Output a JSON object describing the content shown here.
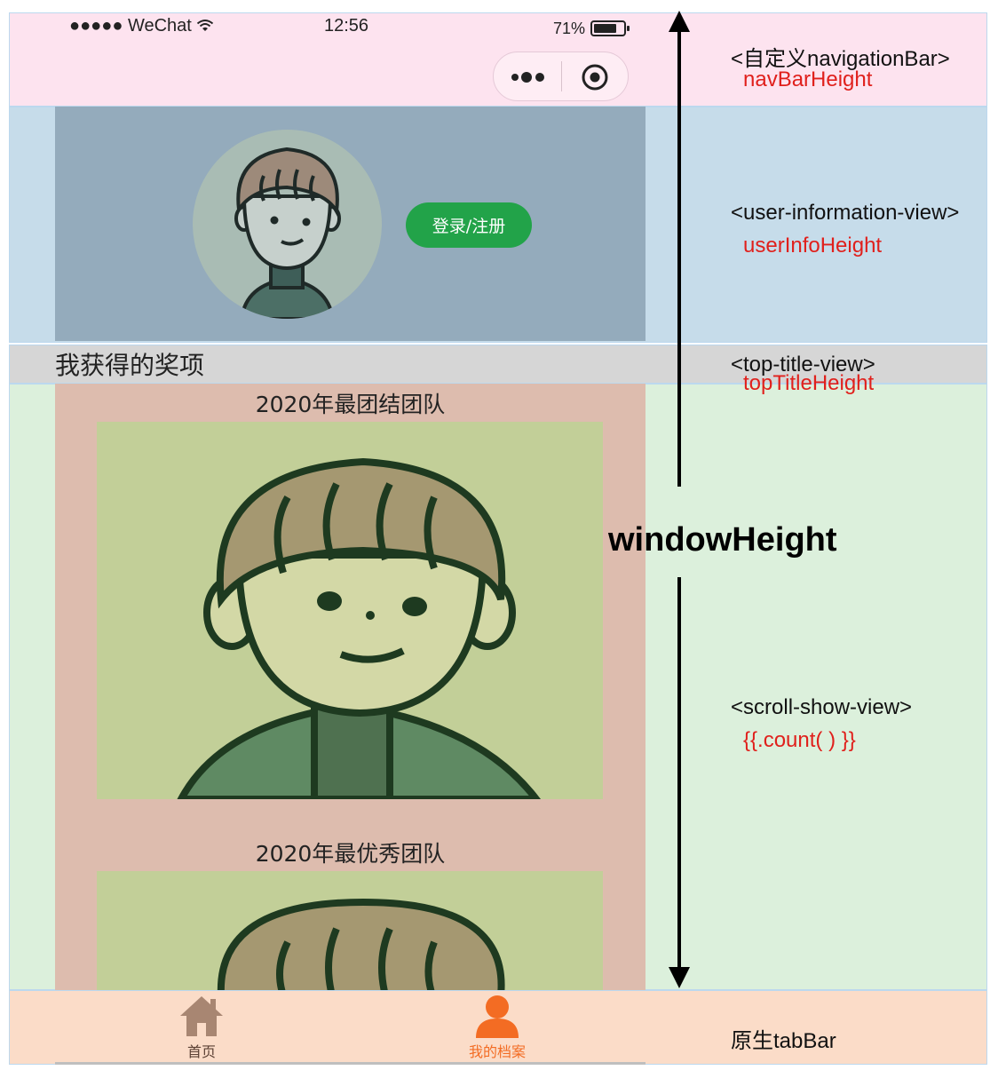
{
  "status_bar": {
    "carrier": "●●●●● WeChat",
    "time": "12:56",
    "battery": "71%"
  },
  "user_info": {
    "login_button": "登录/注册"
  },
  "top_title": {
    "text": "我获得的奖项"
  },
  "awards": [
    {
      "title": "2020年最团结团队"
    },
    {
      "title": "2020年最优秀团队"
    }
  ],
  "tab_bar": {
    "items": [
      {
        "label": "首页",
        "icon": "home-icon",
        "color": "#7a5a4a",
        "icon_color": "#a88672"
      },
      {
        "label": "我的档案",
        "icon": "user-icon",
        "color": "#f36c23",
        "icon_color": "#f36c23"
      }
    ]
  },
  "annotations": {
    "nav_component": "<自定义navigationBar>",
    "nav_var": "navBarHeight",
    "user_component": "<user-information-view>",
    "user_var": "userInfoHeight",
    "top_title_component": "<top-title-view>",
    "top_title_var": "topTitleHeight",
    "window": "windowHeight",
    "scroll_component": "<scroll-show-view>",
    "scroll_var": "{{.count( ) }}",
    "tab_component": "原生tabBar"
  },
  "colors": {
    "nav_band": "#fde3ef",
    "user_band": "#c6dcea",
    "title_band": "#d6d6d6",
    "scroll_band": "#dcf0dc",
    "tab_band": "#fbdcc8",
    "login_green": "#22a349",
    "variable_red": "#e0201c"
  }
}
